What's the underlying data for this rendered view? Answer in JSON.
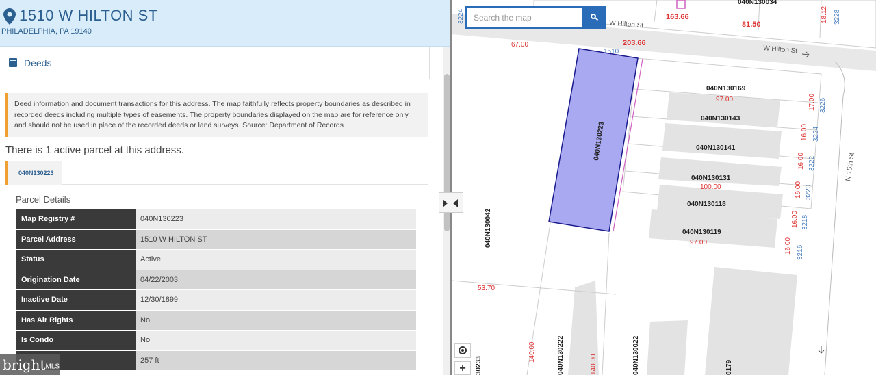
{
  "header": {
    "title": "1510 W HILTON ST",
    "subtitle": "PHILADELPHIA, PA 19140"
  },
  "deeds_tab": {
    "label": "Deeds"
  },
  "info_text": "Deed information and document transactions for this address. The map faithfully reflects property boundaries as described in recorded deeds including multiple types of easements. The property boundaries displayed on the map are for reference only and should not be used in place of the recorded deeds or land surveys. Source: Department of Records",
  "active_parcels_text": "There is 1 active parcel at this address.",
  "parcel_tab": {
    "label": "040N130223"
  },
  "parcel_details": {
    "title": "Parcel Details",
    "rows": [
      {
        "key": "Map Registry #",
        "value": "040N130223"
      },
      {
        "key": "Parcel Address",
        "value": "1510 W HILTON ST"
      },
      {
        "key": "Status",
        "value": "Active"
      },
      {
        "key": "Origination Date",
        "value": "04/22/2003"
      },
      {
        "key": "Inactive Date",
        "value": "12/30/1899"
      },
      {
        "key": "Has Air Rights",
        "value": "No"
      },
      {
        "key": "Is Condo",
        "value": "No"
      },
      {
        "key": "",
        "value": "257 ft"
      }
    ]
  },
  "watermark": {
    "brand": "bright",
    "suffix": "MLS"
  },
  "map": {
    "search_placeholder": "Search the map",
    "streets": {
      "hilton_1": "W Hilton St",
      "hilton_2": "W Hilton St",
      "n15th": "N 15th St"
    },
    "parcel_ids": {
      "selected": "040N130223",
      "p169": "040N130169",
      "p143": "040N130143",
      "p141": "040N130141",
      "p131": "040N130131",
      "p118": "040N130118",
      "p119": "040N130119",
      "p042": "040N130042",
      "p034": "040N130034",
      "p222": "040N130222",
      "p022": "040N130022",
      "p233": "30233",
      "p179": "0179"
    },
    "dimensions": {
      "d16366": "163.66",
      "d8150": "81.50",
      "d20366": "203.66",
      "d6700": "67.00",
      "d1812": "18.12",
      "d9700a": "97.00",
      "d1700": "17.00",
      "d1600a": "16.00",
      "d1600b": "16.00",
      "d1600c": "16.00",
      "d10000": "100.00",
      "d1600d": "16.00",
      "d1600e": "16.00",
      "d9700b": "97.00",
      "d5370": "53.70",
      "d14000a": "140.00",
      "d14000b": "140.00"
    },
    "house_numbers": {
      "h1510": "1510",
      "h3224top": "3224",
      "h3228": "3228",
      "h3226": "3226",
      "h3224": "3224",
      "h3222": "3222",
      "h3220": "3220",
      "h3218": "3218",
      "h3216": "3216"
    },
    "colors": {
      "selected_fill": "#a9a9f2",
      "selected_stroke": "#1a1a8c",
      "dimension": "#dd3333",
      "address": "#4a7fc0"
    }
  }
}
